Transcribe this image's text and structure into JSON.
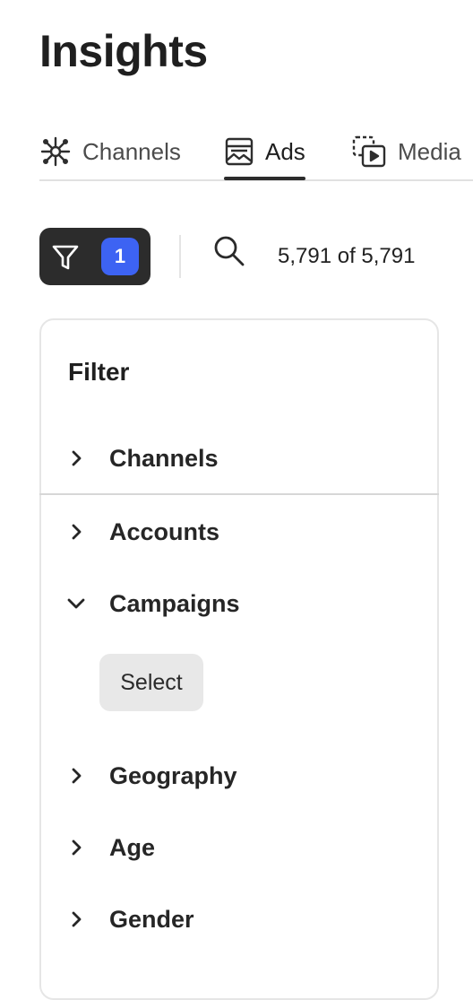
{
  "page": {
    "title": "Insights"
  },
  "tabs": [
    {
      "label": "Channels",
      "icon": "network-icon",
      "selected": false
    },
    {
      "label": "Ads",
      "icon": "ad-image-icon",
      "selected": true
    },
    {
      "label": "Media",
      "icon": "media-icon",
      "selected": false
    }
  ],
  "toolbar": {
    "filter_count": "1",
    "filter_icon": "filter-funnel-icon",
    "search_icon": "search-icon",
    "result_count": "5,791 of 5,791"
  },
  "filter_panel": {
    "heading": "Filter",
    "items": [
      {
        "label": "Channels",
        "expanded": false
      },
      {
        "label": "Accounts",
        "expanded": false
      },
      {
        "label": "Campaigns",
        "expanded": true,
        "action_label": "Select"
      },
      {
        "label": "Geography",
        "expanded": false
      },
      {
        "label": "Age",
        "expanded": false
      },
      {
        "label": "Gender",
        "expanded": false
      }
    ]
  },
  "colors": {
    "badge": "#3d63f3",
    "filter_button_bg": "#2c2c2c",
    "select_button_bg": "#e8e8e8"
  }
}
